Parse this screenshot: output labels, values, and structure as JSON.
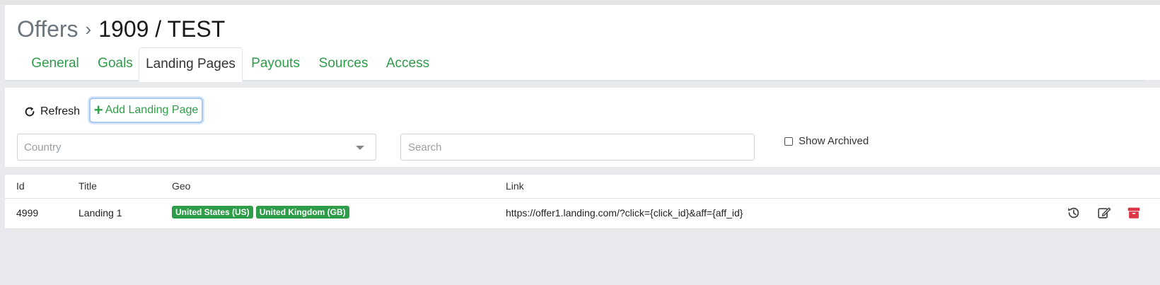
{
  "breadcrumb": {
    "root": "Offers",
    "separator": "›",
    "current": "1909 / TEST"
  },
  "tabs": [
    {
      "label": "General",
      "active": false
    },
    {
      "label": "Goals",
      "active": false
    },
    {
      "label": "Landing Pages",
      "active": true
    },
    {
      "label": "Payouts",
      "active": false
    },
    {
      "label": "Sources",
      "active": false
    },
    {
      "label": "Access",
      "active": false
    }
  ],
  "toolbar": {
    "refresh_label": "Refresh",
    "refresh_icon": "refresh-icon",
    "add_label": "Add Landing Page",
    "add_icon": "plus-icon"
  },
  "filters": {
    "country_placeholder": "Country",
    "search_placeholder": "Search",
    "show_archived_label": "Show Archived",
    "show_archived_checked": false
  },
  "table": {
    "columns": [
      "Id",
      "Title",
      "Geo",
      "Link"
    ],
    "rows": [
      {
        "id": "4999",
        "title": "Landing 1",
        "geo": [
          "United States (US)",
          "United Kingdom (GB)"
        ],
        "link": "https://offer1.landing.com/?click={click_id}&aff={aff_id}",
        "actions": [
          "history-icon",
          "edit-icon",
          "archive-icon"
        ]
      }
    ]
  },
  "colors": {
    "accent_green": "#2e9d4a",
    "danger_red": "#dc3545",
    "page_bg": "#e9e9ee"
  }
}
